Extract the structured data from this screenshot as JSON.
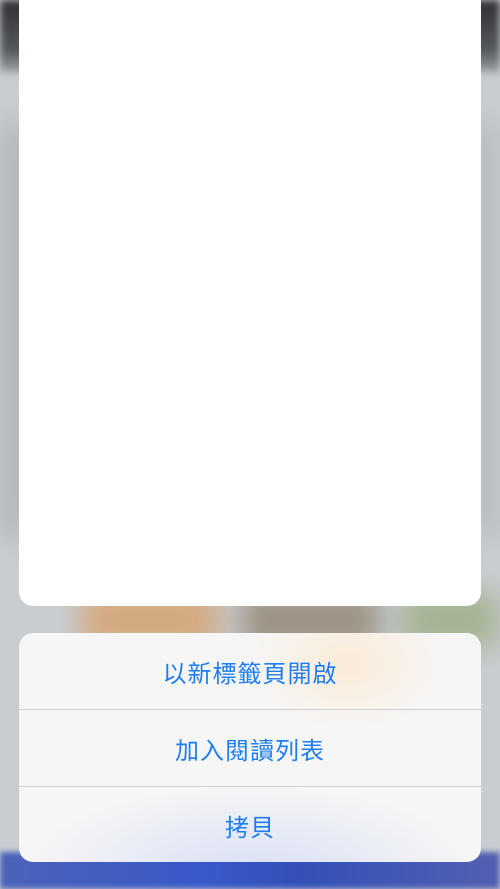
{
  "actions": [
    {
      "label": "以新標籤頁開啟"
    },
    {
      "label": "加入閱讀列表"
    },
    {
      "label": "拷貝"
    }
  ],
  "colors": {
    "action_text": "#1e7ef0",
    "menu_background": "#f6f6f6",
    "preview_background": "#ffffff"
  }
}
